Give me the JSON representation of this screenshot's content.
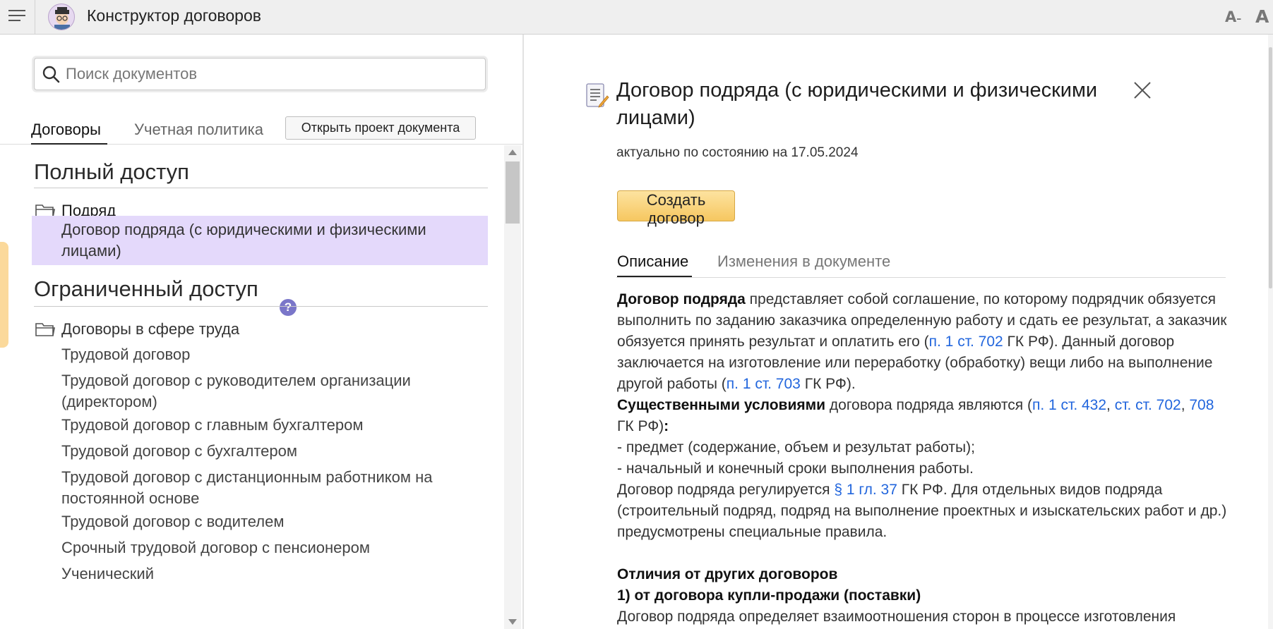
{
  "app": {
    "title": "Конструктор договоров"
  },
  "topbar": {
    "font_small": "A",
    "font_large": "A"
  },
  "search": {
    "placeholder": "Поиск документов"
  },
  "left_tabs": [
    {
      "label": "Договоры",
      "active": true
    },
    {
      "label": "Учетная политика",
      "active": false
    }
  ],
  "open_project_button": "Открыть проект документа",
  "sections": {
    "full_access": "Полный доступ",
    "restricted_access": "Ограниченный доступ",
    "help_badge": "?"
  },
  "folders": {
    "podryad": "Подряд",
    "labor": "Договоры в сфере труда"
  },
  "items": {
    "selected": "Договор подряда (с юридическими и физическими лицами)",
    "labor": [
      "Трудовой договор",
      "Трудовой договор с руководителем организации (директором)",
      "Трудовой договор с главным бухгалтером",
      "Трудовой договор с бухгалтером",
      "Трудовой договор с дистанционным работником на постоянной основе",
      "Трудовой договор с водителем",
      "Срочный трудовой договор с пенсионером",
      "Ученический"
    ]
  },
  "document": {
    "title": "Договор подряда (с юридическими и физическими лицами)",
    "date_text": "актуально по состоянию на 17.05.2024",
    "create_button": "Создать договор",
    "tabs": [
      {
        "label": "Описание",
        "active": true
      },
      {
        "label": "Изменения в документе",
        "active": false
      }
    ],
    "body": {
      "p1_bold": "Договор подряда",
      "p1_text_a": " представляет собой соглашение, по которому подрядчик обязуется выполнить по заданию заказчика определенную работу и сдать ее результат, а заказчик обязуется принять результат и оплатить его (",
      "p1_link1": "п. 1 ст. 702",
      "p1_text_b": " ГК РФ). Данный договор заключается на изготовление или переработку (обработку) вещи либо на выполнение другой работы (",
      "p1_link2": "п. 1 ст. 703",
      "p1_text_c": " ГК РФ).",
      "p2_bold": "Существенными условиями",
      "p2_text_a": " договора подряда являются (",
      "p2_link1": "п. 1 ст. 432",
      "p2_sep": ", ",
      "p2_link2": "ст. ст.  702",
      "p2_sep2": ", ",
      "p2_link3": "708",
      "p2_text_b": " ГК РФ)",
      "p2_colon": ":",
      "li1": "- предмет (содержание, объем и результат работы);",
      "li2": "- начальный и конечный сроки выполнения работы.",
      "p3_text_a": "Договор подряда регулируется ",
      "p3_link": "§ 1 гл. 37",
      "p3_text_b": " ГК РФ. Для отдельных видов подряда (строительный подряд, подряд на выполнение проектных и изыскательских работ и др.) предусмотрены специальные правила.",
      "h_diff": "Отличия от других договоров",
      "h_sale": "1) от договора купли-продажи (поставки)",
      "p4_text": "Договор подряда определяет взаимоотношения сторон в процессе изготовления"
    }
  }
}
